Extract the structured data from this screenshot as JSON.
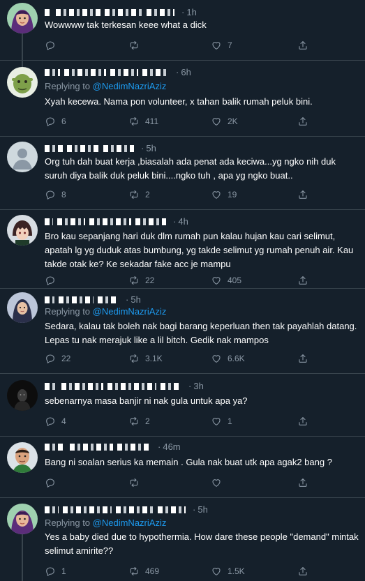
{
  "tweets": [
    {
      "id": "t1",
      "time": "1h",
      "replying_label": "",
      "replying_handle": "",
      "text": "Wowwww tak terkesan keee what a dick",
      "replies": "",
      "retweets": "",
      "likes": "7",
      "avatar": "purple-hair"
    },
    {
      "id": "t2",
      "time": "6h",
      "replying_label": "Replying to",
      "replying_handle": "@NedimNazriAziz",
      "text": "Xyah kecewa. Nama pon volunteer, x tahan balik rumah peluk bini.",
      "replies": "6",
      "retweets": "411",
      "likes": "2K",
      "avatar": "shrek"
    },
    {
      "id": "t3",
      "time": "5h",
      "replying_label": "",
      "replying_handle": "",
      "text": "Org tuh dah buat kerja ,biasalah ada penat ada keciwa...yg ngko nih duk suruh diya balik duk peluk bini....ngko tuh , apa yg ngko buat..",
      "replies": "8",
      "retweets": "2",
      "likes": "19",
      "avatar": "default"
    },
    {
      "id": "t4",
      "time": "4h",
      "replying_label": "",
      "replying_handle": "",
      "text": "Bro kau sepanjang hari duk dlm rumah pun kalau hujan kau cari selimut, apatah lg yg duduk atas bumbung, yg takde selimut yg rumah penuh air. Kau takde otak ke? Ke sekadar fake acc je mampu",
      "replies": "",
      "retweets": "22",
      "likes": "405",
      "avatar": "anime-boy"
    },
    {
      "id": "t5",
      "time": "5h",
      "replying_label": "Replying to",
      "replying_handle": "@NedimNazriAziz",
      "text": "Sedara, kalau tak boleh nak bagi barang keperluan then tak payahlah datang. Lepas tu nak merajuk like a lil bitch. Gedik nak mampos",
      "replies": "22",
      "retweets": "3.1K",
      "likes": "6.6K",
      "avatar": "hijab"
    },
    {
      "id": "t6",
      "time": "3h",
      "replying_label": "",
      "replying_handle": "",
      "text": "sebenarnya masa banjir ni nak gula untuk apa ya?",
      "replies": "4",
      "retweets": "2",
      "likes": "1",
      "avatar": "dark"
    },
    {
      "id": "t7",
      "time": "46m",
      "replying_label": "",
      "replying_handle": "",
      "text": "Bang ni soalan serius ka memain . Gula nak buat utk apa agak2 bang ?",
      "replies": "",
      "retweets": "",
      "likes": "",
      "avatar": "man"
    },
    {
      "id": "t8",
      "time": "5h",
      "replying_label": "Replying to",
      "replying_handle": "@NedimNazriAziz",
      "text": "Yes a baby died due to hypothermia. How dare these people \"demand\" mintak selimut amirite??",
      "replies": "1",
      "retweets": "469",
      "likes": "1.5K",
      "avatar": "purple-hair"
    }
  ],
  "icons": {
    "reply": "reply-icon",
    "retweet": "retweet-icon",
    "like": "heart-icon",
    "share": "share-icon"
  },
  "colors": {
    "background": "#15202b",
    "divider": "#38444d",
    "muted": "#8b98a5",
    "link": "#1d9bf0",
    "text": "#ffffff"
  }
}
